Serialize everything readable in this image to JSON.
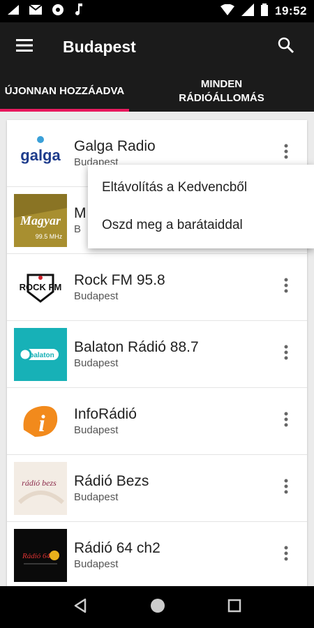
{
  "status": {
    "time": "19:52"
  },
  "appbar": {
    "title": "Budapest"
  },
  "tabs": [
    {
      "label": "ÚJONNAN HOZZÁADVA",
      "active": true
    },
    {
      "label": "MINDEN RÁDIÓÁLLOMÁS",
      "active": false
    }
  ],
  "stations": [
    {
      "name": "Galga Radio",
      "city": "Budapest",
      "logo_text": "galga"
    },
    {
      "name": "M",
      "city": "B",
      "logo_text": "Magyar",
      "logo_sub": "99.5 MHz"
    },
    {
      "name": "Rock FM 95.8",
      "city": "Budapest",
      "logo_text": "ROCK FM"
    },
    {
      "name": "Balaton Rádió 88.7",
      "city": "Budapest",
      "logo_text": "balaton"
    },
    {
      "name": "InfoRádió",
      "city": "Budapest",
      "logo_text": "i"
    },
    {
      "name": "Rádió Bezs",
      "city": "Budapest",
      "logo_text": "rádió bezs"
    },
    {
      "name": "Rádió 64 ch2",
      "city": "Budapest",
      "logo_text": "Rádió 64"
    }
  ],
  "popup": {
    "items": [
      {
        "label": "Eltávolítás a Kedvencből"
      },
      {
        "label": "Oszd meg a barátaiddal"
      }
    ]
  },
  "colors": {
    "accent": "#e8185d",
    "appbar": "#1b1b1b"
  }
}
